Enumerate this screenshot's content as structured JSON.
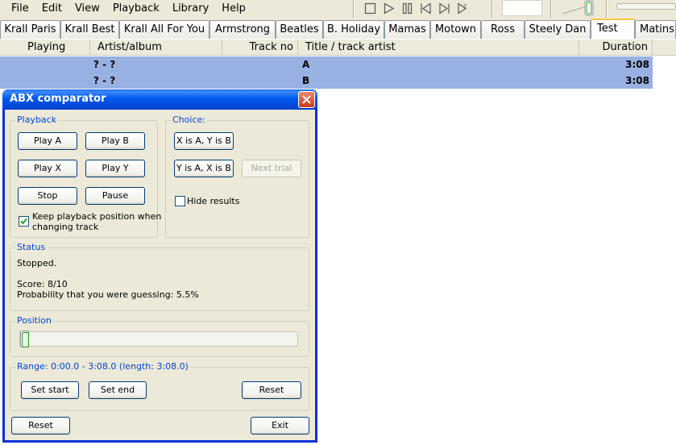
{
  "menu": [
    "File",
    "Edit",
    "View",
    "Playback",
    "Library",
    "Help"
  ],
  "toolbar_icons": [
    "stop-icon",
    "play-icon",
    "pause-icon",
    "previous-icon",
    "next-icon",
    "random-icon"
  ],
  "tabs": [
    "Krall Paris",
    "Krall Best",
    "Krall All For You",
    "Armstrong",
    "Beatles",
    "B. Holiday",
    "Mamas",
    "Motown",
    "Ross",
    "Steely Dan",
    "Test",
    "Matins"
  ],
  "active_tab": "Test",
  "playlist": {
    "columns": [
      "Playing",
      "Artist/album",
      "Track no",
      "Title / track artist",
      "Duration"
    ],
    "rows": [
      {
        "playing": "",
        "artist_album": "? - ?",
        "track_no": "",
        "title": "A",
        "duration": "3:08"
      },
      {
        "playing": "",
        "artist_album": "? - ?",
        "track_no": "",
        "title": "B",
        "duration": "3:08"
      }
    ]
  },
  "dialog": {
    "title": "ABX comparator",
    "playback": {
      "label": "Playback",
      "play_a": "Play A",
      "play_b": "Play B",
      "play_x": "Play X",
      "play_y": "Play Y",
      "stop": "Stop",
      "pause": "Pause",
      "keep_position_line1": "Keep playback position when",
      "keep_position_line2": "changing track",
      "keep_position_checked": true
    },
    "choice": {
      "label": "Choice:",
      "x_is_a": "X is A, Y is B",
      "y_is_a": "Y is A, X is B",
      "next_trial": "Next trial",
      "hide_results": "Hide results",
      "hide_results_checked": false
    },
    "status": {
      "label": "Status",
      "state": "Stopped.",
      "score": "Score: 8/10",
      "probability": "Probability that you were guessing: 5.5%"
    },
    "position": {
      "label": "Position",
      "value": 0
    },
    "range": {
      "label": "Range: 0:00.0 - 3:08.0 (length: 3:08.0)",
      "set_start": "Set start",
      "set_end": "Set end",
      "reset": "Reset"
    },
    "footer": {
      "reset": "Reset",
      "exit": "Exit"
    }
  }
}
